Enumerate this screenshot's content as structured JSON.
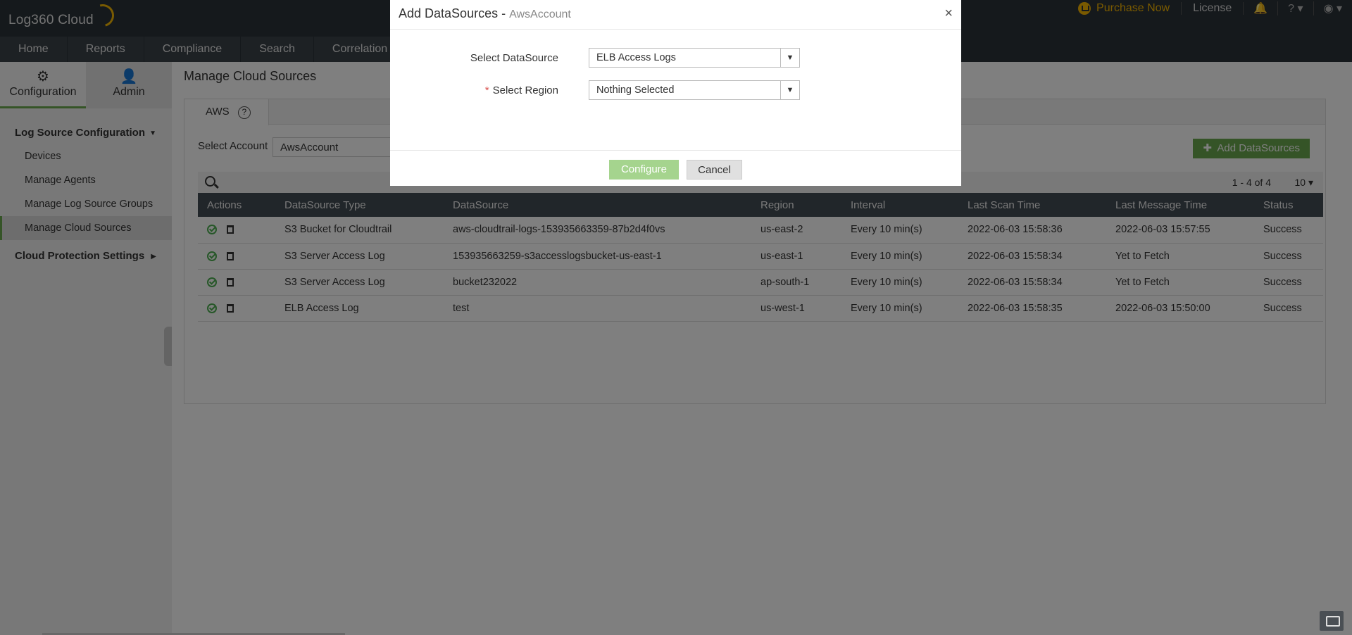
{
  "header": {
    "logo": "Log360 Cloud",
    "nav": [
      "Home",
      "Reports",
      "Compliance",
      "Search",
      "Correlation"
    ],
    "purchase": "Purchase Now",
    "license": "License",
    "help": "?",
    "bell_icon": "bell-icon",
    "user_icon": "user-icon"
  },
  "sidebar": {
    "tabs": [
      {
        "label": "Configuration",
        "icon": "gear-icon",
        "active": true
      },
      {
        "label": "Admin",
        "icon": "user-icon",
        "active": false
      }
    ],
    "group1": "Log Source Configuration",
    "items": [
      "Devices",
      "Manage Agents",
      "Manage Log Source Groups",
      "Manage Cloud Sources"
    ],
    "active_item": "Manage Cloud Sources",
    "group2": "Cloud Protection Settings"
  },
  "main": {
    "title": "Manage Cloud Sources",
    "tab": "AWS",
    "select_account_label": "Select Account",
    "select_account_value": "AwsAccount",
    "add_button": "Add DataSources",
    "pager": "1 - 4 of 4",
    "per_page": "10",
    "columns": [
      "Actions",
      "DataSource Type",
      "DataSource",
      "Region",
      "Interval",
      "Last Scan Time",
      "Last Message Time",
      "Status"
    ],
    "rows": [
      {
        "type": "S3 Bucket for Cloudtrail",
        "source": "aws-cloudtrail-logs-153935663359-87b2d4f0vs",
        "region": "us-east-2",
        "interval": "Every 10 min(s)",
        "scan": "2022-06-03 15:58:36",
        "message": "2022-06-03 15:57:55",
        "status": "Success"
      },
      {
        "type": "S3 Server Access Log",
        "source": "153935663259-s3accesslogsbucket-us-east-1",
        "region": "us-east-1",
        "interval": "Every 10 min(s)",
        "scan": "2022-06-03 15:58:34",
        "message": "Yet to Fetch",
        "status": "Success"
      },
      {
        "type": "S3 Server Access Log",
        "source": "bucket232022",
        "region": "ap-south-1",
        "interval": "Every 10 min(s)",
        "scan": "2022-06-03 15:58:34",
        "message": "Yet to Fetch",
        "status": "Success"
      },
      {
        "type": "ELB Access Log",
        "source": "test",
        "region": "us-west-1",
        "interval": "Every 10 min(s)",
        "scan": "2022-06-03 15:58:35",
        "message": "2022-06-03 15:50:00",
        "status": "Success"
      }
    ]
  },
  "modal": {
    "title": "Add DataSources - ",
    "account": "AwsAccount",
    "close": "×",
    "datasource_label": "Select DataSource",
    "datasource_value": "ELB Access Logs",
    "region_required": "*",
    "region_label": "Select Region",
    "region_value": "Nothing Selected",
    "configure": "Configure",
    "cancel": "Cancel"
  },
  "colors": {
    "header_bg": "#2b3238",
    "accent_green": "#6aa84f",
    "purchase_yellow": "#f4b400"
  }
}
